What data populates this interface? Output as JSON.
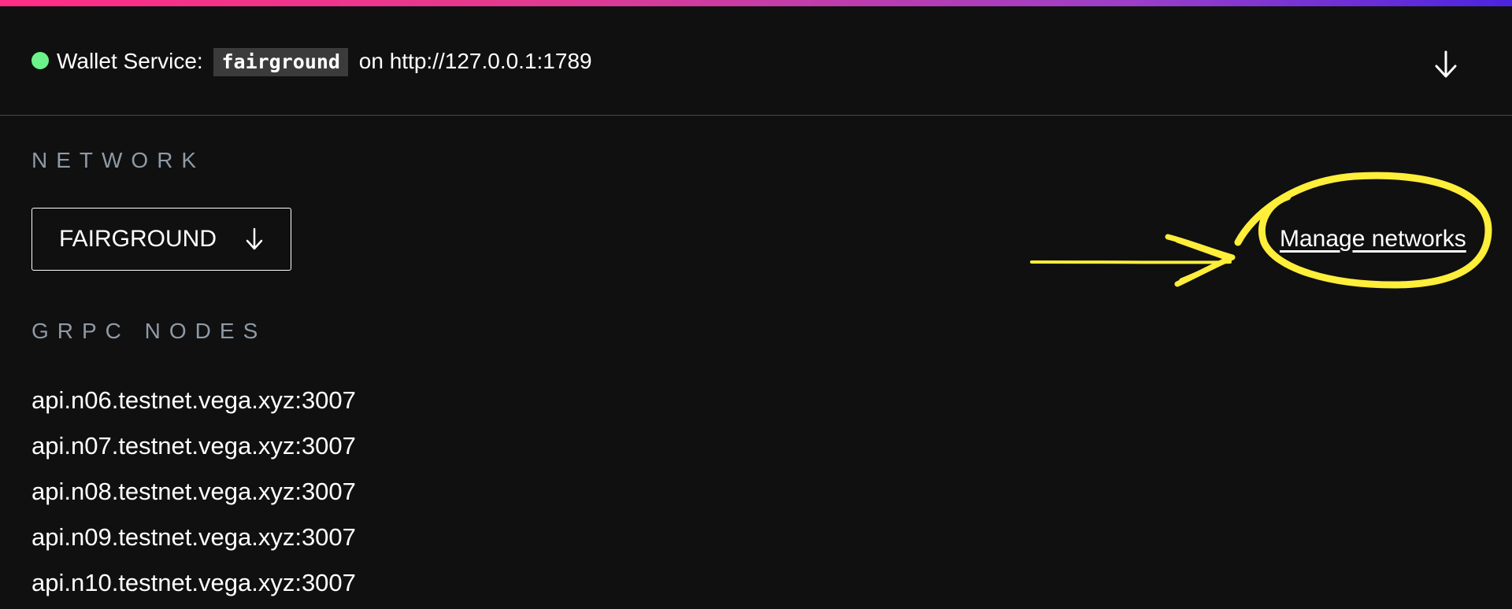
{
  "header": {
    "status_label": "Wallet Service:",
    "service_name": "fairground",
    "on_text": "on",
    "service_url": "http://127.0.0.1:1789"
  },
  "network_section": {
    "label": "NETWORK",
    "selected_network": "FAIRGROUND",
    "manage_link": "Manage networks"
  },
  "grpc_section": {
    "label": "GRPC NODES",
    "nodes": [
      "api.n06.testnet.vega.xyz:3007",
      "api.n07.testnet.vega.xyz:3007",
      "api.n08.testnet.vega.xyz:3007",
      "api.n09.testnet.vega.xyz:3007",
      "api.n10.testnet.vega.xyz:3007"
    ]
  },
  "icons": {
    "status": "status-dot-icon",
    "collapse": "arrow-down-icon",
    "dropdown": "arrow-down-icon"
  },
  "colors": {
    "background": "#101010",
    "status_ok": "#6cf48a",
    "label_gray": "#8e9aa6",
    "annotation": "#ffee3a",
    "gradient_start": "#ff2d86",
    "gradient_end": "#4b24e0"
  }
}
